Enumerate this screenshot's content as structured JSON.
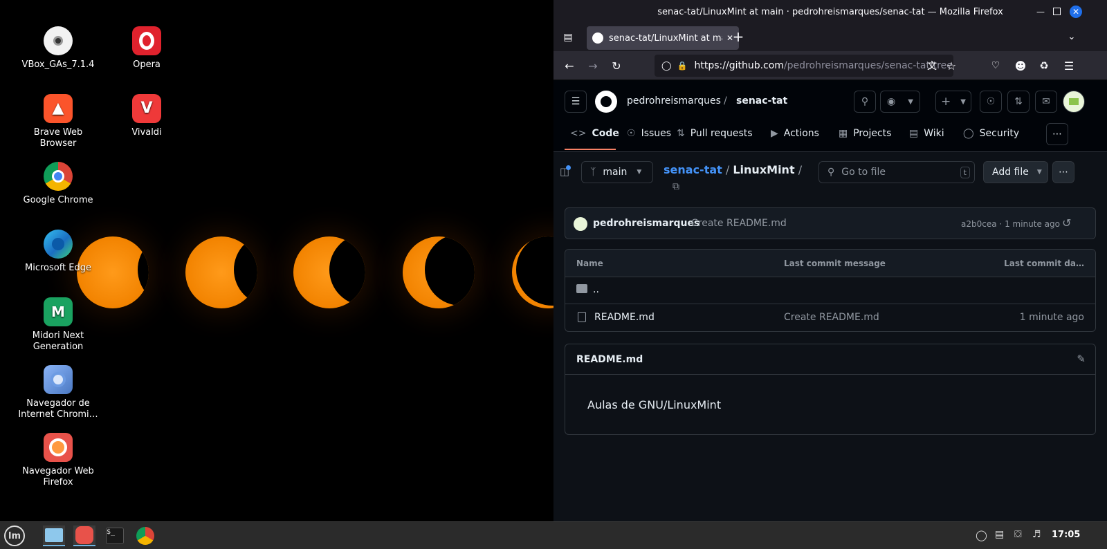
{
  "desktop": {
    "icons": [
      {
        "label": "VBox_GAs_7.1.4"
      },
      {
        "label": "Opera"
      },
      {
        "label": "Brave Web Browser"
      },
      {
        "label": "Vivaldi"
      },
      {
        "label": "Google Chrome"
      },
      {
        "label": "Microsoft Edge"
      },
      {
        "label": "Midori Next Generation"
      },
      {
        "label": "Navegador de Internet Chromi…"
      },
      {
        "label": "Navegador Web Firefox"
      }
    ]
  },
  "firefox": {
    "window_title": "senac-tat/LinuxMint at main · pedrohreismarques/senac-tat — Mozilla Firefox",
    "tab_title": "senac-tat/LinuxMint at main",
    "url_host": "https://github.com",
    "url_path": "/pedrohreismarques/senac-tat/tree/m"
  },
  "github": {
    "owner": "pedrohreismarques",
    "separator": "/",
    "repo": "senac-tat",
    "tabs": [
      {
        "label": "Code"
      },
      {
        "label": "Issues"
      },
      {
        "label": "Pull requests"
      },
      {
        "label": "Actions"
      },
      {
        "label": "Projects"
      },
      {
        "label": "Wiki"
      },
      {
        "label": "Security"
      }
    ],
    "branch": "main",
    "breadcrumb_repo": "senac-tat",
    "breadcrumb_sep": "/",
    "breadcrumb_dir": "LinuxMint",
    "breadcrumb_trail": "/",
    "goto_placeholder": "Go to file",
    "goto_kbd": "t",
    "add_file": "Add file",
    "commit": {
      "author": "pedrohreismarques",
      "message": "Create README.md",
      "hash": "a2b0cea",
      "dot": "·",
      "time": "1 minute ago"
    },
    "table": {
      "headers": [
        "Name",
        "Last commit message",
        "Last commit da…"
      ],
      "parent": "..",
      "rows": [
        {
          "name": "README.md",
          "message": "Create README.md",
          "date": "1 minute ago"
        }
      ]
    },
    "readme": {
      "title": "README.md",
      "body": "Aulas de GNU/LinuxMint"
    }
  },
  "taskbar": {
    "clock": "17:05"
  },
  "colors": {
    "accent_blue": "#4493f8",
    "github_bg": "#0d1117",
    "tab_underline": "#f78166",
    "firefox_chrome": "#1c1b22"
  }
}
